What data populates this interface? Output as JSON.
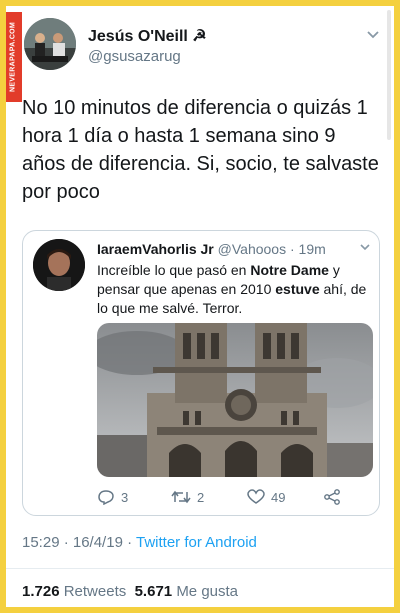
{
  "watermark": "NEVERAPAPA.COM",
  "tweet": {
    "display_name": "Jesús O'Neill ☭",
    "handle": "@gsusazarug",
    "text": "No 10 minutos de diferencia o quizás 1 hora 1 día o hasta 1 semana sino 9 años de diferencia. Si, socio, te salvaste por poco",
    "timestamp": "15:29 · 16/4/19 · ",
    "source": "Twitter for Android",
    "retweets_count": "1.726",
    "retweets_label": "Retweets",
    "likes_count": "5.671",
    "likes_label": "Me gusta"
  },
  "quoted": {
    "name": "IaraemVahorlis Jr",
    "handle": "@Vahooos",
    "time": "· 19m",
    "text_1": "Increíble lo que pasó en ",
    "text_bold_1": "Notre Dame",
    "text_2": " y pensar que apenas en 2010 ",
    "text_bold_2": "estuve",
    "text_3": " ahí, de lo que me salvé. Terror.",
    "replies": "3",
    "retweets": "2",
    "likes": "49"
  },
  "icons": {
    "caret": "chevron-down-icon",
    "reply": "reply-icon",
    "retweet": "retweet-icon",
    "like": "heart-icon",
    "share": "share-icon"
  },
  "colors": {
    "background": "#f4d03f",
    "link": "#1da1f2",
    "secondary_text": "#657786"
  }
}
